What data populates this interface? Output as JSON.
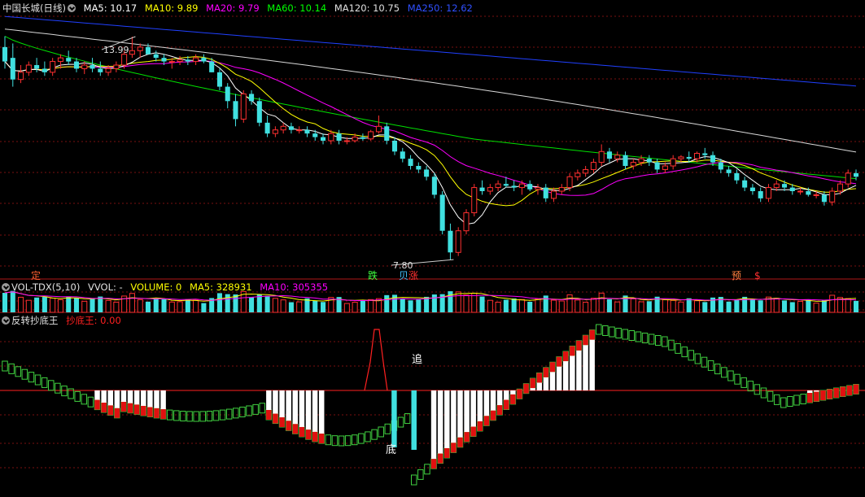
{
  "main": {
    "title": "中国长城(日线)",
    "ma": [
      {
        "label": "MA5: 10.17",
        "color": "#ffffff"
      },
      {
        "label": "MA10: 9.89",
        "color": "#ffff00"
      },
      {
        "label": "MA20: 9.79",
        "color": "#ff00ff"
      },
      {
        "label": "MA60: 10.14",
        "color": "#00ff00"
      },
      {
        "label": "MA120: 10.75",
        "color": "#e0e0e0"
      },
      {
        "label": "MA250: 12.62",
        "color": "#2040ff"
      }
    ],
    "high_label": "13.99",
    "low_label": "7.80",
    "signals": [
      {
        "text": "定",
        "color": "#ff6030"
      },
      {
        "text": "跌",
        "color": "#40ff40"
      },
      {
        "text": "贝",
        "color": "#40c0ff"
      },
      {
        "text": "涨",
        "color": "#ff3030"
      },
      {
        "text": "预",
        "color": "#ff8040"
      },
      {
        "text": "$",
        "color": "#ff3030"
      }
    ]
  },
  "volume": {
    "title": "VOL-TDX(5,10)",
    "items": [
      {
        "label": "VVOL: -",
        "color": "#e0e0e0"
      },
      {
        "label": "VOLUME: 0",
        "color": "#ffff00"
      },
      {
        "label": "MA5: 328931",
        "color": "#ffff00"
      },
      {
        "label": "MA10: 305355",
        "color": "#ff00ff"
      }
    ]
  },
  "indicator": {
    "title": "反转抄底王",
    "value_label": "抄底王: 0.00",
    "value_color": "#ff2020",
    "annot_chase": "追",
    "annot_bottom": "底"
  },
  "chart_data": [
    {
      "type": "candlestick",
      "title": "中国长城(日线)",
      "y_range": [
        7.6,
        14.6
      ],
      "annotations": [
        "13.99",
        "7.80"
      ],
      "ohlc": [
        [
          13.7,
          14.0,
          13.1,
          13.3
        ],
        [
          13.4,
          13.8,
          12.6,
          12.8
        ],
        [
          12.8,
          13.2,
          12.7,
          13.0
        ],
        [
          13.0,
          13.3,
          12.9,
          13.2
        ],
        [
          13.2,
          13.4,
          13.0,
          13.1
        ],
        [
          13.1,
          13.3,
          12.9,
          13.0
        ],
        [
          13.0,
          13.4,
          12.9,
          13.3
        ],
        [
          13.3,
          13.5,
          13.1,
          13.4
        ],
        [
          13.4,
          13.6,
          13.2,
          13.3
        ],
        [
          13.3,
          13.4,
          13.0,
          13.1
        ],
        [
          13.1,
          13.3,
          12.95,
          13.2
        ],
        [
          13.2,
          13.4,
          13.0,
          13.1
        ],
        [
          13.1,
          13.3,
          12.9,
          13.0
        ],
        [
          13.0,
          13.2,
          12.9,
          13.1
        ],
        [
          13.1,
          13.3,
          13.0,
          13.2
        ],
        [
          13.2,
          13.6,
          13.1,
          13.5
        ],
        [
          13.5,
          13.99,
          13.4,
          13.6
        ],
        [
          13.6,
          13.8,
          13.4,
          13.7
        ],
        [
          13.7,
          13.8,
          13.5,
          13.5
        ],
        [
          13.5,
          13.6,
          13.3,
          13.4
        ],
        [
          13.4,
          13.5,
          13.2,
          13.3
        ],
        [
          13.3,
          13.4,
          13.1,
          13.3
        ],
        [
          13.3,
          13.45,
          13.2,
          13.35
        ],
        [
          13.35,
          13.45,
          13.2,
          13.3
        ],
        [
          13.3,
          13.5,
          13.2,
          13.4
        ],
        [
          13.4,
          13.5,
          13.25,
          13.3
        ],
        [
          13.3,
          13.4,
          13.0,
          13.0
        ],
        [
          13.0,
          13.1,
          12.5,
          12.6
        ],
        [
          12.6,
          12.7,
          12.0,
          12.2
        ],
        [
          12.2,
          12.4,
          11.5,
          11.7
        ],
        [
          11.7,
          12.5,
          11.6,
          12.4
        ],
        [
          12.4,
          12.5,
          12.1,
          12.2
        ],
        [
          12.2,
          12.3,
          11.5,
          11.6
        ],
        [
          11.6,
          11.8,
          11.2,
          11.3
        ],
        [
          11.3,
          11.5,
          11.2,
          11.4
        ],
        [
          11.4,
          11.6,
          11.3,
          11.5
        ],
        [
          11.5,
          11.6,
          11.3,
          11.4
        ],
        [
          11.4,
          11.5,
          11.3,
          11.4
        ],
        [
          11.4,
          11.5,
          11.2,
          11.3
        ],
        [
          11.3,
          11.4,
          11.1,
          11.2
        ],
        [
          11.2,
          11.3,
          11.0,
          11.1
        ],
        [
          11.1,
          11.4,
          11.0,
          11.3
        ],
        [
          11.3,
          11.4,
          11.0,
          11.1
        ],
        [
          11.1,
          11.2,
          11.0,
          11.1
        ],
        [
          11.1,
          11.3,
          11.05,
          11.2
        ],
        [
          11.2,
          11.3,
          11.1,
          11.15
        ],
        [
          11.15,
          11.4,
          11.1,
          11.35
        ],
        [
          11.35,
          11.8,
          11.3,
          11.5
        ],
        [
          11.5,
          11.6,
          11.0,
          11.1
        ],
        [
          11.1,
          11.2,
          10.7,
          10.8
        ],
        [
          10.8,
          10.9,
          10.5,
          10.6
        ],
        [
          10.6,
          10.7,
          10.3,
          10.4
        ],
        [
          10.4,
          10.5,
          10.2,
          10.3
        ],
        [
          10.3,
          10.4,
          10.0,
          10.1
        ],
        [
          10.1,
          10.2,
          9.5,
          9.6
        ],
        [
          9.6,
          9.7,
          8.5,
          8.6
        ],
        [
          8.6,
          8.8,
          7.8,
          8.0
        ],
        [
          8.0,
          8.7,
          7.9,
          8.6
        ],
        [
          8.6,
          9.2,
          8.5,
          9.1
        ],
        [
          9.1,
          9.9,
          9.0,
          9.8
        ],
        [
          9.8,
          10.0,
          9.6,
          9.7
        ],
        [
          9.7,
          9.9,
          9.6,
          9.8
        ],
        [
          9.8,
          10.0,
          9.7,
          9.9
        ],
        [
          9.9,
          10.1,
          9.8,
          9.85
        ],
        [
          9.85,
          10.0,
          9.7,
          9.8
        ],
        [
          9.8,
          10.0,
          9.6,
          9.9
        ],
        [
          9.9,
          10.0,
          9.7,
          9.75
        ],
        [
          9.75,
          9.9,
          9.6,
          9.8
        ],
        [
          9.8,
          9.9,
          9.4,
          9.5
        ],
        [
          9.5,
          9.8,
          9.4,
          9.7
        ],
        [
          9.7,
          9.9,
          9.6,
          9.8
        ],
        [
          9.8,
          10.2,
          9.7,
          10.1
        ],
        [
          10.1,
          10.3,
          10.0,
          10.2
        ],
        [
          10.2,
          10.4,
          10.1,
          10.3
        ],
        [
          10.3,
          10.6,
          10.2,
          10.5
        ],
        [
          10.5,
          11.0,
          10.4,
          10.8
        ],
        [
          10.8,
          10.9,
          10.5,
          10.6
        ],
        [
          10.6,
          10.8,
          10.5,
          10.7
        ],
        [
          10.7,
          10.8,
          10.3,
          10.4
        ],
        [
          10.4,
          10.6,
          10.3,
          10.5
        ],
        [
          10.5,
          10.7,
          10.4,
          10.6
        ],
        [
          10.6,
          10.7,
          10.4,
          10.5
        ],
        [
          10.5,
          10.6,
          10.2,
          10.3
        ],
        [
          10.3,
          10.5,
          10.2,
          10.4
        ],
        [
          10.4,
          10.7,
          10.3,
          10.6
        ],
        [
          10.6,
          10.7,
          10.5,
          10.65
        ],
        [
          10.65,
          10.8,
          10.5,
          10.6
        ],
        [
          10.6,
          10.8,
          10.5,
          10.75
        ],
        [
          10.75,
          10.9,
          10.6,
          10.7
        ],
        [
          10.7,
          10.8,
          10.4,
          10.5
        ],
        [
          10.5,
          10.6,
          10.2,
          10.3
        ],
        [
          10.3,
          10.4,
          10.1,
          10.2
        ],
        [
          10.2,
          10.3,
          9.9,
          10.0
        ],
        [
          10.0,
          10.1,
          9.7,
          9.8
        ],
        [
          9.8,
          9.9,
          9.6,
          9.7
        ],
        [
          9.7,
          9.8,
          9.4,
          9.5
        ],
        [
          9.5,
          9.9,
          9.4,
          9.8
        ],
        [
          9.8,
          10.0,
          9.7,
          9.9
        ],
        [
          9.9,
          10.0,
          9.7,
          9.8
        ],
        [
          9.8,
          9.9,
          9.6,
          9.7
        ],
        [
          9.7,
          9.8,
          9.6,
          9.7
        ],
        [
          9.7,
          9.8,
          9.55,
          9.6
        ],
        [
          9.6,
          9.7,
          9.5,
          9.6
        ],
        [
          9.6,
          9.7,
          9.3,
          9.4
        ],
        [
          9.4,
          9.8,
          9.3,
          9.7
        ],
        [
          9.7,
          10.0,
          9.6,
          9.9
        ],
        [
          9.9,
          10.3,
          9.8,
          10.2
        ],
        [
          10.2,
          10.3,
          10.0,
          10.1
        ]
      ]
    },
    {
      "type": "bar",
      "title": "VOL-TDX(5,10)",
      "legend": [
        "VVOL: -",
        "VOLUME: 0",
        "MA5: 328931",
        "MA10: 305355"
      ]
    },
    {
      "type": "bar",
      "title": "反转抄底王",
      "legend": [
        "抄底王: 0.00"
      ]
    }
  ]
}
